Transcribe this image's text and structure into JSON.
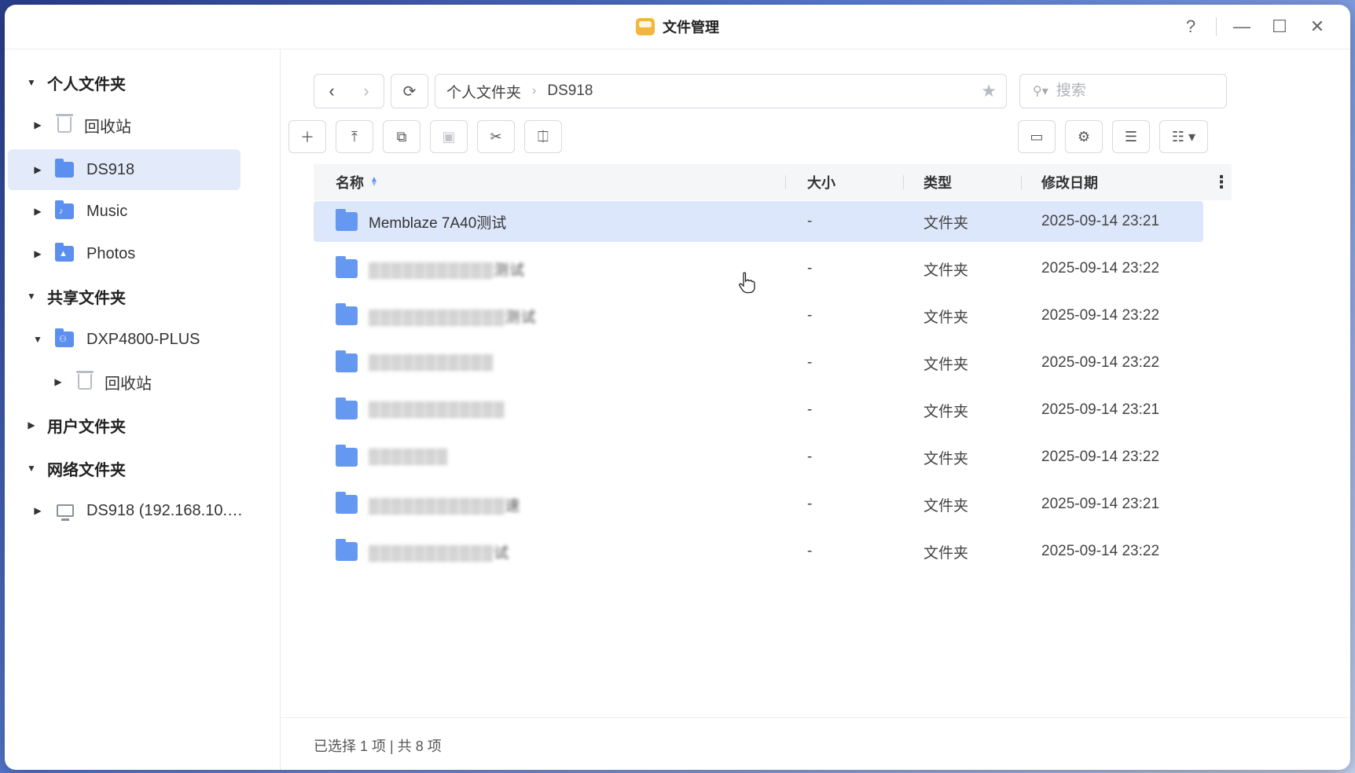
{
  "window": {
    "title": "文件管理",
    "controls": {
      "help": "?",
      "minimize": "—",
      "maximize": "☐",
      "close": "✕"
    }
  },
  "sidebar": {
    "groups": [
      {
        "label": "个人文件夹",
        "expanded": true
      },
      {
        "label": "共享文件夹",
        "expanded": true
      },
      {
        "label": "用户文件夹",
        "expanded": false
      },
      {
        "label": "网络文件夹",
        "expanded": true
      }
    ],
    "items": [
      {
        "label": "回收站",
        "icon": "trash-icon"
      },
      {
        "label": "DS918",
        "icon": "folder-icon",
        "selected": true
      },
      {
        "label": "Music",
        "icon": "music-folder-icon"
      },
      {
        "label": "Photos",
        "icon": "photo-folder-icon"
      },
      {
        "label": "DXP4800-PLUS",
        "icon": "shared-folder-icon"
      },
      {
        "label": "回收站",
        "icon": "trash-icon"
      },
      {
        "label": "DS918 (192.168.10.…",
        "icon": "monitor-icon"
      }
    ]
  },
  "toolbar": {
    "path": {
      "root": "个人文件夹",
      "current": "DS918",
      "separator": "›"
    },
    "search": {
      "placeholder": "搜索",
      "value": ""
    }
  },
  "table": {
    "columns": {
      "name": "名称",
      "size": "大小",
      "type": "类型",
      "modified": "修改日期"
    },
    "rows": [
      {
        "name": "Memblaze 7A40测试",
        "size": "-",
        "type": "文件夹",
        "modified": "2025-09-14 23:21",
        "selected": true
      },
      {
        "name": "▒▒▒▒▒▒▒▒▒▒▒测试",
        "size": "-",
        "type": "文件夹",
        "modified": "2025-09-14 23:22"
      },
      {
        "name": "▒▒▒▒▒▒▒▒▒▒▒▒测试",
        "size": "-",
        "type": "文件夹",
        "modified": "2025-09-14 23:22"
      },
      {
        "name": "▒▒▒▒▒▒▒▒▒▒▒",
        "size": "-",
        "type": "文件夹",
        "modified": "2025-09-14 23:22"
      },
      {
        "name": "▒▒▒▒▒▒▒▒▒▒▒▒",
        "size": "-",
        "type": "文件夹",
        "modified": "2025-09-14 23:21"
      },
      {
        "name": "▒▒▒▒▒▒▒",
        "size": "-",
        "type": "文件夹",
        "modified": "2025-09-14 23:22"
      },
      {
        "name": "▒▒▒▒▒▒▒▒▒▒▒▒速",
        "size": "-",
        "type": "文件夹",
        "modified": "2025-09-14 23:21"
      },
      {
        "name": "▒▒▒▒▒▒▒▒▒▒▒试",
        "size": "-",
        "type": "文件夹",
        "modified": "2025-09-14 23:22"
      }
    ]
  },
  "status": {
    "text": "已选择 1 项 | 共 8 项"
  },
  "colors": {
    "accent": "#5b8ff0",
    "selection": "#dde7fb",
    "folder": "#6598f1"
  }
}
